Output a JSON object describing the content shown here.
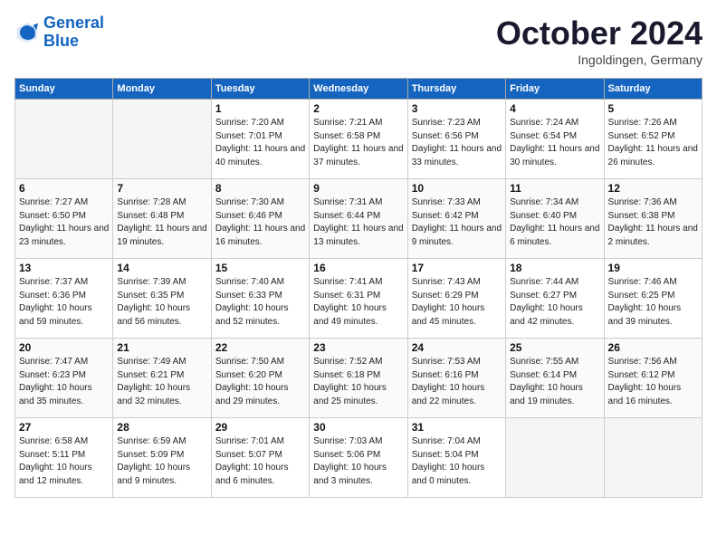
{
  "header": {
    "logo_line1": "General",
    "logo_line2": "Blue",
    "month": "October 2024",
    "location": "Ingoldingen, Germany"
  },
  "weekdays": [
    "Sunday",
    "Monday",
    "Tuesday",
    "Wednesday",
    "Thursday",
    "Friday",
    "Saturday"
  ],
  "weeks": [
    [
      {
        "day": "",
        "detail": ""
      },
      {
        "day": "",
        "detail": ""
      },
      {
        "day": "1",
        "detail": "Sunrise: 7:20 AM\nSunset: 7:01 PM\nDaylight: 11 hours and 40 minutes."
      },
      {
        "day": "2",
        "detail": "Sunrise: 7:21 AM\nSunset: 6:58 PM\nDaylight: 11 hours and 37 minutes."
      },
      {
        "day": "3",
        "detail": "Sunrise: 7:23 AM\nSunset: 6:56 PM\nDaylight: 11 hours and 33 minutes."
      },
      {
        "day": "4",
        "detail": "Sunrise: 7:24 AM\nSunset: 6:54 PM\nDaylight: 11 hours and 30 minutes."
      },
      {
        "day": "5",
        "detail": "Sunrise: 7:26 AM\nSunset: 6:52 PM\nDaylight: 11 hours and 26 minutes."
      }
    ],
    [
      {
        "day": "6",
        "detail": "Sunrise: 7:27 AM\nSunset: 6:50 PM\nDaylight: 11 hours and 23 minutes."
      },
      {
        "day": "7",
        "detail": "Sunrise: 7:28 AM\nSunset: 6:48 PM\nDaylight: 11 hours and 19 minutes."
      },
      {
        "day": "8",
        "detail": "Sunrise: 7:30 AM\nSunset: 6:46 PM\nDaylight: 11 hours and 16 minutes."
      },
      {
        "day": "9",
        "detail": "Sunrise: 7:31 AM\nSunset: 6:44 PM\nDaylight: 11 hours and 13 minutes."
      },
      {
        "day": "10",
        "detail": "Sunrise: 7:33 AM\nSunset: 6:42 PM\nDaylight: 11 hours and 9 minutes."
      },
      {
        "day": "11",
        "detail": "Sunrise: 7:34 AM\nSunset: 6:40 PM\nDaylight: 11 hours and 6 minutes."
      },
      {
        "day": "12",
        "detail": "Sunrise: 7:36 AM\nSunset: 6:38 PM\nDaylight: 11 hours and 2 minutes."
      }
    ],
    [
      {
        "day": "13",
        "detail": "Sunrise: 7:37 AM\nSunset: 6:36 PM\nDaylight: 10 hours and 59 minutes."
      },
      {
        "day": "14",
        "detail": "Sunrise: 7:39 AM\nSunset: 6:35 PM\nDaylight: 10 hours and 56 minutes."
      },
      {
        "day": "15",
        "detail": "Sunrise: 7:40 AM\nSunset: 6:33 PM\nDaylight: 10 hours and 52 minutes."
      },
      {
        "day": "16",
        "detail": "Sunrise: 7:41 AM\nSunset: 6:31 PM\nDaylight: 10 hours and 49 minutes."
      },
      {
        "day": "17",
        "detail": "Sunrise: 7:43 AM\nSunset: 6:29 PM\nDaylight: 10 hours and 45 minutes."
      },
      {
        "day": "18",
        "detail": "Sunrise: 7:44 AM\nSunset: 6:27 PM\nDaylight: 10 hours and 42 minutes."
      },
      {
        "day": "19",
        "detail": "Sunrise: 7:46 AM\nSunset: 6:25 PM\nDaylight: 10 hours and 39 minutes."
      }
    ],
    [
      {
        "day": "20",
        "detail": "Sunrise: 7:47 AM\nSunset: 6:23 PM\nDaylight: 10 hours and 35 minutes."
      },
      {
        "day": "21",
        "detail": "Sunrise: 7:49 AM\nSunset: 6:21 PM\nDaylight: 10 hours and 32 minutes."
      },
      {
        "day": "22",
        "detail": "Sunrise: 7:50 AM\nSunset: 6:20 PM\nDaylight: 10 hours and 29 minutes."
      },
      {
        "day": "23",
        "detail": "Sunrise: 7:52 AM\nSunset: 6:18 PM\nDaylight: 10 hours and 25 minutes."
      },
      {
        "day": "24",
        "detail": "Sunrise: 7:53 AM\nSunset: 6:16 PM\nDaylight: 10 hours and 22 minutes."
      },
      {
        "day": "25",
        "detail": "Sunrise: 7:55 AM\nSunset: 6:14 PM\nDaylight: 10 hours and 19 minutes."
      },
      {
        "day": "26",
        "detail": "Sunrise: 7:56 AM\nSunset: 6:12 PM\nDaylight: 10 hours and 16 minutes."
      }
    ],
    [
      {
        "day": "27",
        "detail": "Sunrise: 6:58 AM\nSunset: 5:11 PM\nDaylight: 10 hours and 12 minutes."
      },
      {
        "day": "28",
        "detail": "Sunrise: 6:59 AM\nSunset: 5:09 PM\nDaylight: 10 hours and 9 minutes."
      },
      {
        "day": "29",
        "detail": "Sunrise: 7:01 AM\nSunset: 5:07 PM\nDaylight: 10 hours and 6 minutes."
      },
      {
        "day": "30",
        "detail": "Sunrise: 7:03 AM\nSunset: 5:06 PM\nDaylight: 10 hours and 3 minutes."
      },
      {
        "day": "31",
        "detail": "Sunrise: 7:04 AM\nSunset: 5:04 PM\nDaylight: 10 hours and 0 minutes."
      },
      {
        "day": "",
        "detail": ""
      },
      {
        "day": "",
        "detail": ""
      }
    ]
  ]
}
